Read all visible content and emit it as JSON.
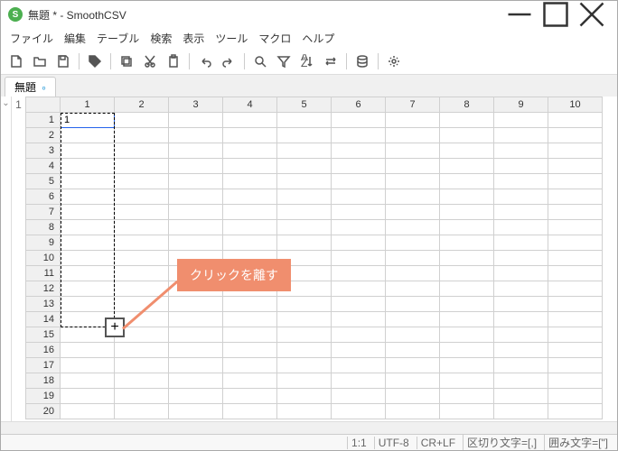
{
  "window": {
    "title": "無題 * - SmoothCSV",
    "app_initial": "S"
  },
  "menu": {
    "items": [
      "ファイル",
      "編集",
      "テーブル",
      "検索",
      "表示",
      "ツール",
      "マクロ",
      "ヘルプ"
    ]
  },
  "tab": {
    "label": "無題"
  },
  "row_indicator": "1",
  "columns": [
    "1",
    "2",
    "3",
    "4",
    "5",
    "6",
    "7",
    "8",
    "9",
    "10"
  ],
  "rows": [
    "1",
    "2",
    "3",
    "4",
    "5",
    "6",
    "7",
    "8",
    "9",
    "10",
    "11",
    "12",
    "13",
    "14",
    "15",
    "16",
    "17",
    "18",
    "19",
    "20"
  ],
  "cells": {
    "r0c0": "1"
  },
  "overlay": {
    "callout": "クリックを離す"
  },
  "status": {
    "pos": "1:1",
    "enc": "UTF-8",
    "eol": "CR+LF",
    "delim": "区切り文字=[,]",
    "quote": "囲み文字=[\"]"
  }
}
